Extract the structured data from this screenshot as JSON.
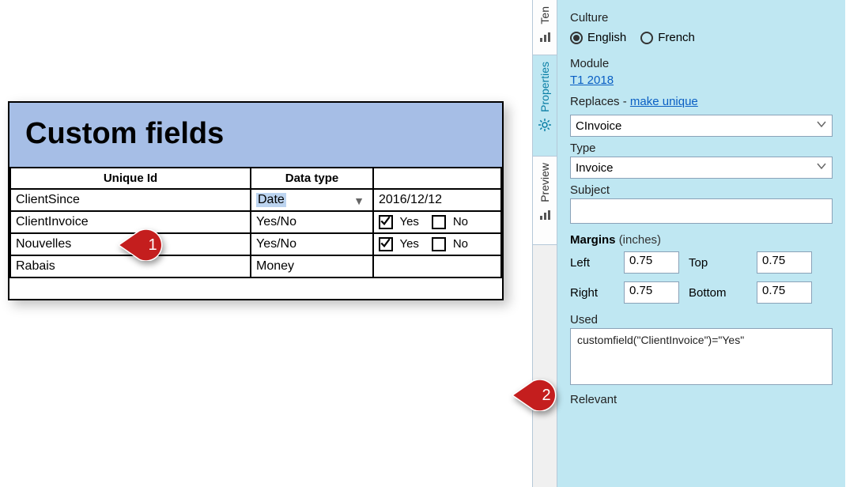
{
  "leftPanel": {
    "title": "Custom fields",
    "headers": [
      "Unique Id",
      "Data type",
      ""
    ],
    "rows": [
      {
        "id": "ClientSince",
        "type": "Date",
        "type_selected": true,
        "value": "2016/12/12"
      },
      {
        "id": "ClientInvoice",
        "type": "Yes/No",
        "yes": "Yes",
        "no": "No",
        "yes_checked": true,
        "no_checked": false
      },
      {
        "id": "Nouvelles",
        "type": "Yes/No",
        "yes": "Yes",
        "no": "No",
        "yes_checked": true,
        "no_checked": false
      },
      {
        "id": "Rabais",
        "type": "Money",
        "value": ""
      }
    ]
  },
  "callouts": {
    "one": "1",
    "two": "2"
  },
  "tabs": {
    "ten": "Ten",
    "properties": "Properties",
    "preview": "Preview"
  },
  "props": {
    "culture_label": "Culture",
    "culture_english": "English",
    "culture_french": "French",
    "module_label": "Module",
    "module_link": "T1 2018",
    "replaces_label": "Replaces - ",
    "replaces_link": "make unique",
    "replaces_value": "CInvoice",
    "type_label": "Type",
    "type_value": "Invoice",
    "subject_label": "Subject",
    "subject_value": "",
    "margins_label": "Margins",
    "margins_unit": "(inches)",
    "left_label": "Left",
    "left_value": "0.75",
    "top_label": "Top",
    "top_value": "0.75",
    "right_label": "Right",
    "right_value": "0.75",
    "bottom_label": "Bottom",
    "bottom_value": "0.75",
    "used_label": "Used",
    "used_expr": "customfield(\"ClientInvoice\")=\"Yes\"",
    "relevant_label": "Relevant"
  }
}
